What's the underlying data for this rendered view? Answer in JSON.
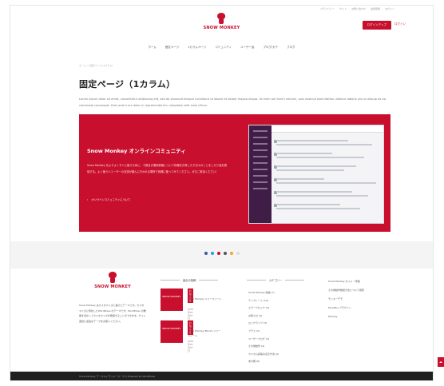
{
  "topbar": {
    "links": [
      "プライバシー",
      "サイト",
      "お問い合わせ",
      "会員登録",
      "ログイン"
    ]
  },
  "header": {
    "logo_text": "SNOW MONKEY",
    "cta_label": "ログインアップ",
    "login_label": "ログイン"
  },
  "nav": {
    "items": [
      "ホーム",
      "固定ページ",
      "1カラムページ",
      "コミュニティ",
      "ユーザー会",
      "ブログ/カテ",
      "ブログ"
    ]
  },
  "breadcrumb": "ホーム > 固定ページ (1カラム)",
  "page": {
    "title": "固定ページ（1カラム）",
    "lead": "Lorem ipsum dolor sit amet, consectetur adipiscing elit, sed do eiusmod tempor incididunt ut labore et dolore magna aliqua. Ut enim ad minim veniam, quis nostrud exercitation ullamco laboris nisi ut aliquip ex ea commodo consequat. Duis aute irure dolor in reprehenderit in voluptate velit esse cillum."
  },
  "hero": {
    "title": "Snow Monkey オンラインコミュニティ",
    "text": "Snow Monkey をよりよくすぐに使うために、十数名が運用情報について情報を共有したり日々のことをしたり話を発信する。よく使う人ユーザーの交流が盛んに行われる場所で気軽に使ってみてください。ぜひご参加ください！",
    "link_label": "オンラインコミュニティについて"
  },
  "footer": {
    "logo_text": "SNOW MONKEY",
    "about": "Snow Monkey はカスタマイズに長けたテーマです。カスタマイズに特化したWordPress のテーマです。WordPress の機能を活かしてカスタマイズを発揮することができます。サイト運営に最適なテーマをお使いください。",
    "recent_heading": "最近の投稿",
    "posts": [
      {
        "thumb": "SNOW MONKEY",
        "tag": "お知らせ",
        "title": "Snow Monkey リリースノート",
        "date": "2019年03月03日"
      },
      {
        "thumb": "SNOW MONKEY",
        "tag": "お知らせ",
        "title": "Snow Monkey Blocks リリースノート",
        "date": "2019年03月03日"
      }
    ],
    "cats_heading": "カテゴリー",
    "cats": [
      "Snow Monkey 関連 (7)",
      "テンプレート (10)",
      "エラーブロック (3)",
      "お知らせ (4)",
      "ロックライブ (3)",
      "プラス (2)",
      "ユーザーブログ (4)",
      "その他動作 (4)",
      "カスタム投稿の表示方法 (2)",
      "未分類 (6)"
    ],
    "links": [
      "Snow Monkey ガイド・特徴",
      "その他動作確認方法について用意",
      "モンキーデモ",
      "FacePlus ブラグイン",
      "Monkey"
    ]
  },
  "social": {
    "colors": [
      "#3b5998",
      "#1da1f2",
      "#c8102e",
      "#555555",
      "#f5a623",
      "#dddddd"
    ]
  },
  "bottom": {
    "credit": "Snow Monkey テーマ by モンキーワークス Powered by WordPress"
  },
  "colors": {
    "accent": "#c8102e",
    "dark_footer": "#1f1f1f"
  }
}
